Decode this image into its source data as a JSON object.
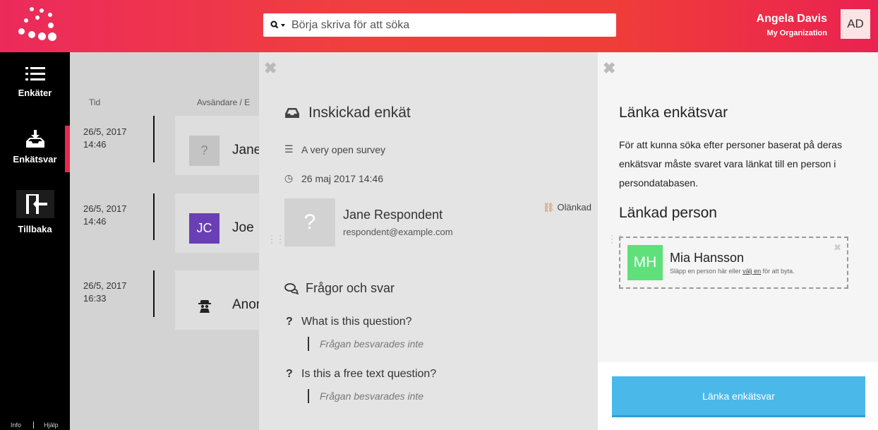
{
  "header": {
    "search_placeholder": "Börja skriva för att söka",
    "user_name": "Angela Davis",
    "user_org": "My Organization",
    "user_initials": "AD"
  },
  "nav": {
    "items": [
      {
        "label": "Enkäter",
        "icon": "list-icon"
      },
      {
        "label": "Enkätsvar",
        "icon": "inbox-icon"
      },
      {
        "label": "Tillbaka",
        "icon": "exit-icon"
      }
    ],
    "footer_info": "Info",
    "footer_help": "Hjälp"
  },
  "list": {
    "col_time": "Tid",
    "col_sender": "Avsändare / E",
    "rows": [
      {
        "date": "26/5, 2017",
        "time": "14:46",
        "avatar": "?",
        "name": "Jane"
      },
      {
        "date": "26/5, 2017",
        "time": "14:46",
        "avatar": "JC",
        "name": "Joe"
      },
      {
        "date": "26/5, 2017",
        "time": "16:33",
        "avatar": "spy-icon",
        "name": "Anon"
      }
    ]
  },
  "submission": {
    "title": "Inskickad enkät",
    "survey": "A very open survey",
    "date": "26 maj 2017 14:46",
    "respondent_avatar": "?",
    "respondent_name": "Jane Respondent",
    "respondent_email": "respondent@example.com",
    "status": "Olänkad",
    "qa_heading": "Frågor och svar",
    "questions": [
      {
        "q": "What is this question?",
        "a": "Frågan besvarades inte"
      },
      {
        "q": "Is this a free text question?",
        "a": "Frågan besvarades inte"
      }
    ]
  },
  "link_panel": {
    "title": "Länka enkätsvar",
    "description": "För att kunna söka efter personer baserat på deras enkätsvar måste svaret vara länkat till en person i persondatabasen.",
    "linked_heading": "Länkad person",
    "person_initials": "MH",
    "person_name": "Mia Hansson",
    "hint_prefix": "Släpp en person här eller ",
    "hint_link": "välj en",
    "hint_suffix": " för att byta.",
    "button_label": "Länka enkätsvar"
  },
  "colors": {
    "accent": "#ec2a5b",
    "active_nav": "#e8284c",
    "person_green": "#5fe07a",
    "jc_purple": "#6a3fb5",
    "button_blue": "#4bb8ea"
  }
}
